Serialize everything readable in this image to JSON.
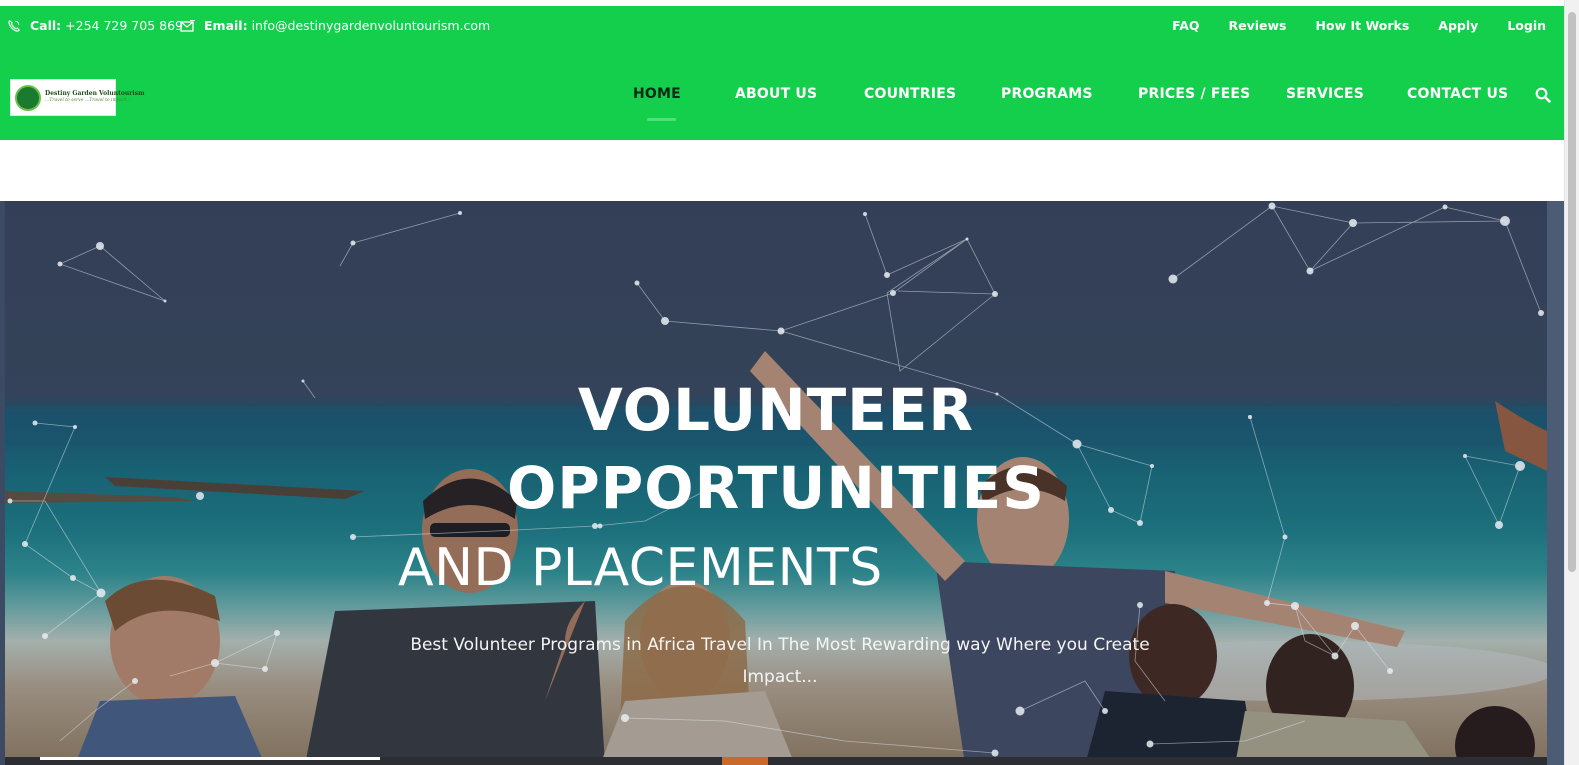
{
  "topbar": {
    "phone_label": "Call:",
    "phone_value": "+254 729 705 869",
    "email_label": "Email:",
    "email_value": "info@destinygardenvoluntourism.com",
    "links": [
      "FAQ",
      "Reviews",
      "How It Works",
      "Apply",
      "Login"
    ]
  },
  "logo": {
    "title": "Destiny Garden Voluntourism",
    "tagline": "...Travel to serve ...Travel to impact..."
  },
  "nav": {
    "items": [
      "HOME",
      "ABOUT US",
      "COUNTRIES",
      "PROGRAMS",
      "PRICES / FEES",
      "SERVICES",
      "CONTACT US"
    ],
    "active": "HOME"
  },
  "hero": {
    "title_line_1": "VOLUNTEER",
    "title_line_2": "OPPORTUNITIES",
    "title_line_3": "AND PLACEMENTS",
    "subtitle": "Best Volunteer Programs in Africa Travel In The Most Rewarding way Where you Create Impact..."
  },
  "icons": {
    "phone": "phone-icon",
    "email": "envelope-icon",
    "search": "search-icon"
  },
  "colors": {
    "header_green": "#13cf4b",
    "active_nav_text": "#0c2a15",
    "active_underline": "#4ee07a",
    "hero_text": "#ffffff"
  }
}
